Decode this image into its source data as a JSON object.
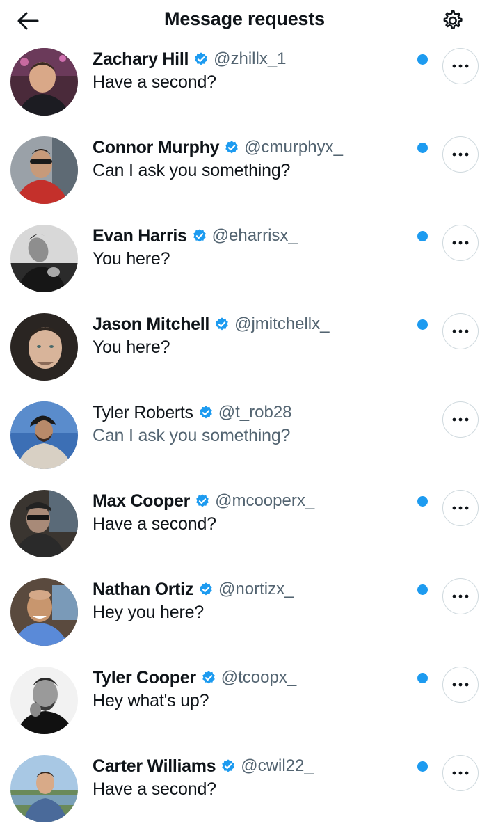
{
  "header": {
    "title": "Message requests",
    "back_icon": "arrow-left-icon",
    "settings_icon": "gear-icon"
  },
  "colors": {
    "accent": "#1d9bf0",
    "text_primary": "#0f1419",
    "text_secondary": "#536471",
    "border": "#cfd9de"
  },
  "requests": [
    {
      "name": "Zachary Hill",
      "handle": "@zhillx_1",
      "message": "Have a second?",
      "unread": true,
      "verified": true
    },
    {
      "name": "Connor Murphy",
      "handle": "@cmurphyx_",
      "message": "Can I ask you something?",
      "unread": true,
      "verified": true
    },
    {
      "name": "Evan Harris",
      "handle": "@eharrisx_",
      "message": "You here?",
      "unread": true,
      "verified": true
    },
    {
      "name": "Jason Mitchell",
      "handle": "@jmitchellx_",
      "message": "You here?",
      "unread": true,
      "verified": true
    },
    {
      "name": "Tyler Roberts",
      "handle": "@t_rob28",
      "message": "Can I ask you something?",
      "unread": false,
      "verified": true
    },
    {
      "name": "Max Cooper",
      "handle": "@mcooperx_",
      "message": "Have a second?",
      "unread": true,
      "verified": true
    },
    {
      "name": "Nathan Ortiz",
      "handle": "@nortizx_",
      "message": "Hey you here?",
      "unread": true,
      "verified": true
    },
    {
      "name": "Tyler Cooper",
      "handle": "@tcoopx_",
      "message": "Hey what's up?",
      "unread": true,
      "verified": true
    },
    {
      "name": "Carter Williams",
      "handle": "@cwil22_",
      "message": "Have a second?",
      "unread": true,
      "verified": true
    }
  ]
}
